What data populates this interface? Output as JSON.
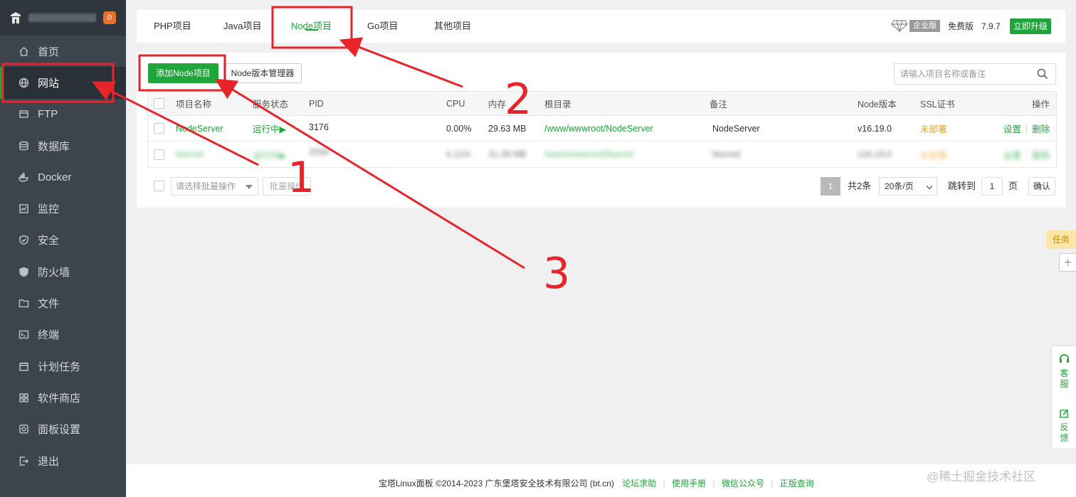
{
  "sidebar": {
    "badge": "0",
    "items": [
      {
        "label": "首页",
        "icon": "home-icon"
      },
      {
        "label": "网站",
        "icon": "globe-icon"
      },
      {
        "label": "FTP",
        "icon": "ftp-icon"
      },
      {
        "label": "数据库",
        "icon": "database-icon"
      },
      {
        "label": "Docker",
        "icon": "docker-icon"
      },
      {
        "label": "监控",
        "icon": "monitor-icon"
      },
      {
        "label": "安全",
        "icon": "shield-icon"
      },
      {
        "label": "防火墙",
        "icon": "firewall-icon"
      },
      {
        "label": "文件",
        "icon": "folder-icon"
      },
      {
        "label": "终端",
        "icon": "terminal-icon"
      },
      {
        "label": "计划任务",
        "icon": "calendar-icon"
      },
      {
        "label": "软件商店",
        "icon": "apps-icon"
      },
      {
        "label": "面板设置",
        "icon": "settings-icon"
      },
      {
        "label": "退出",
        "icon": "logout-icon"
      }
    ]
  },
  "tabs": [
    "PHP项目",
    "Java项目",
    "Node项目",
    "Go项目",
    "其他项目"
  ],
  "topbar": {
    "enterprise": "企业版",
    "free": "免费版",
    "version": "7.9.7",
    "upgrade": "立即升级"
  },
  "toolbar": {
    "add_node": "添加Node项目",
    "node_manager": "Node版本管理器",
    "search_placeholder": "请输入项目名称或备注"
  },
  "table": {
    "columns": [
      "项目名称",
      "服务状态",
      "PID",
      "CPU",
      "内存",
      "根目录",
      "备注",
      "Node版本",
      "SSL证书",
      "操作"
    ],
    "rows": [
      {
        "name": "NodeServer",
        "status": "运行中▶",
        "pid": "3176",
        "cpu": "0.00%",
        "mem": "29.63 MB",
        "root": "/www/wwwroot/NodeServer",
        "note": "NodeServer",
        "node_version": "v16.19.0",
        "ssl": "未部署",
        "action_set": "设置",
        "action_del": "删除"
      },
      {
        "name": "blurred",
        "status": "运行中▶",
        "pid": "3339",
        "cpu": "0.11%",
        "mem": "31.28 MB",
        "root": "/www/wwwroot/blurred",
        "note": "blurred",
        "node_version": "v16.19.0",
        "ssl": "未部署",
        "action_set": "设置",
        "action_del": "删除"
      }
    ]
  },
  "batch": {
    "select_placeholder": "请选择批量操作",
    "button": "批量操作"
  },
  "pagination": {
    "current": "1",
    "total": "共2条",
    "per_page": "20条/页",
    "jump_to": "跳转到",
    "jump_value": "1",
    "page_unit": "页",
    "confirm": "确认"
  },
  "float": {
    "task": "任务",
    "plus": "+",
    "service_1": "客",
    "service_2": "服",
    "feedback_1": "反",
    "feedback_2": "馈"
  },
  "footer": {
    "copyright": "宝塔Linux面板 ©2014-2023 广东堡塔安全技术有限公司 (bt.cn)",
    "links": [
      "论坛求助",
      "使用手册",
      "微信公众号",
      "正版查询"
    ]
  },
  "watermark": "@稀土掘金技术社区",
  "annotations": {
    "n1": "1",
    "n2": "2",
    "n3": "3",
    "color": "#e8232a"
  },
  "colors": {
    "accent": "#20a53a",
    "sidebar": "#3c444d",
    "warning": "#f0a020"
  }
}
